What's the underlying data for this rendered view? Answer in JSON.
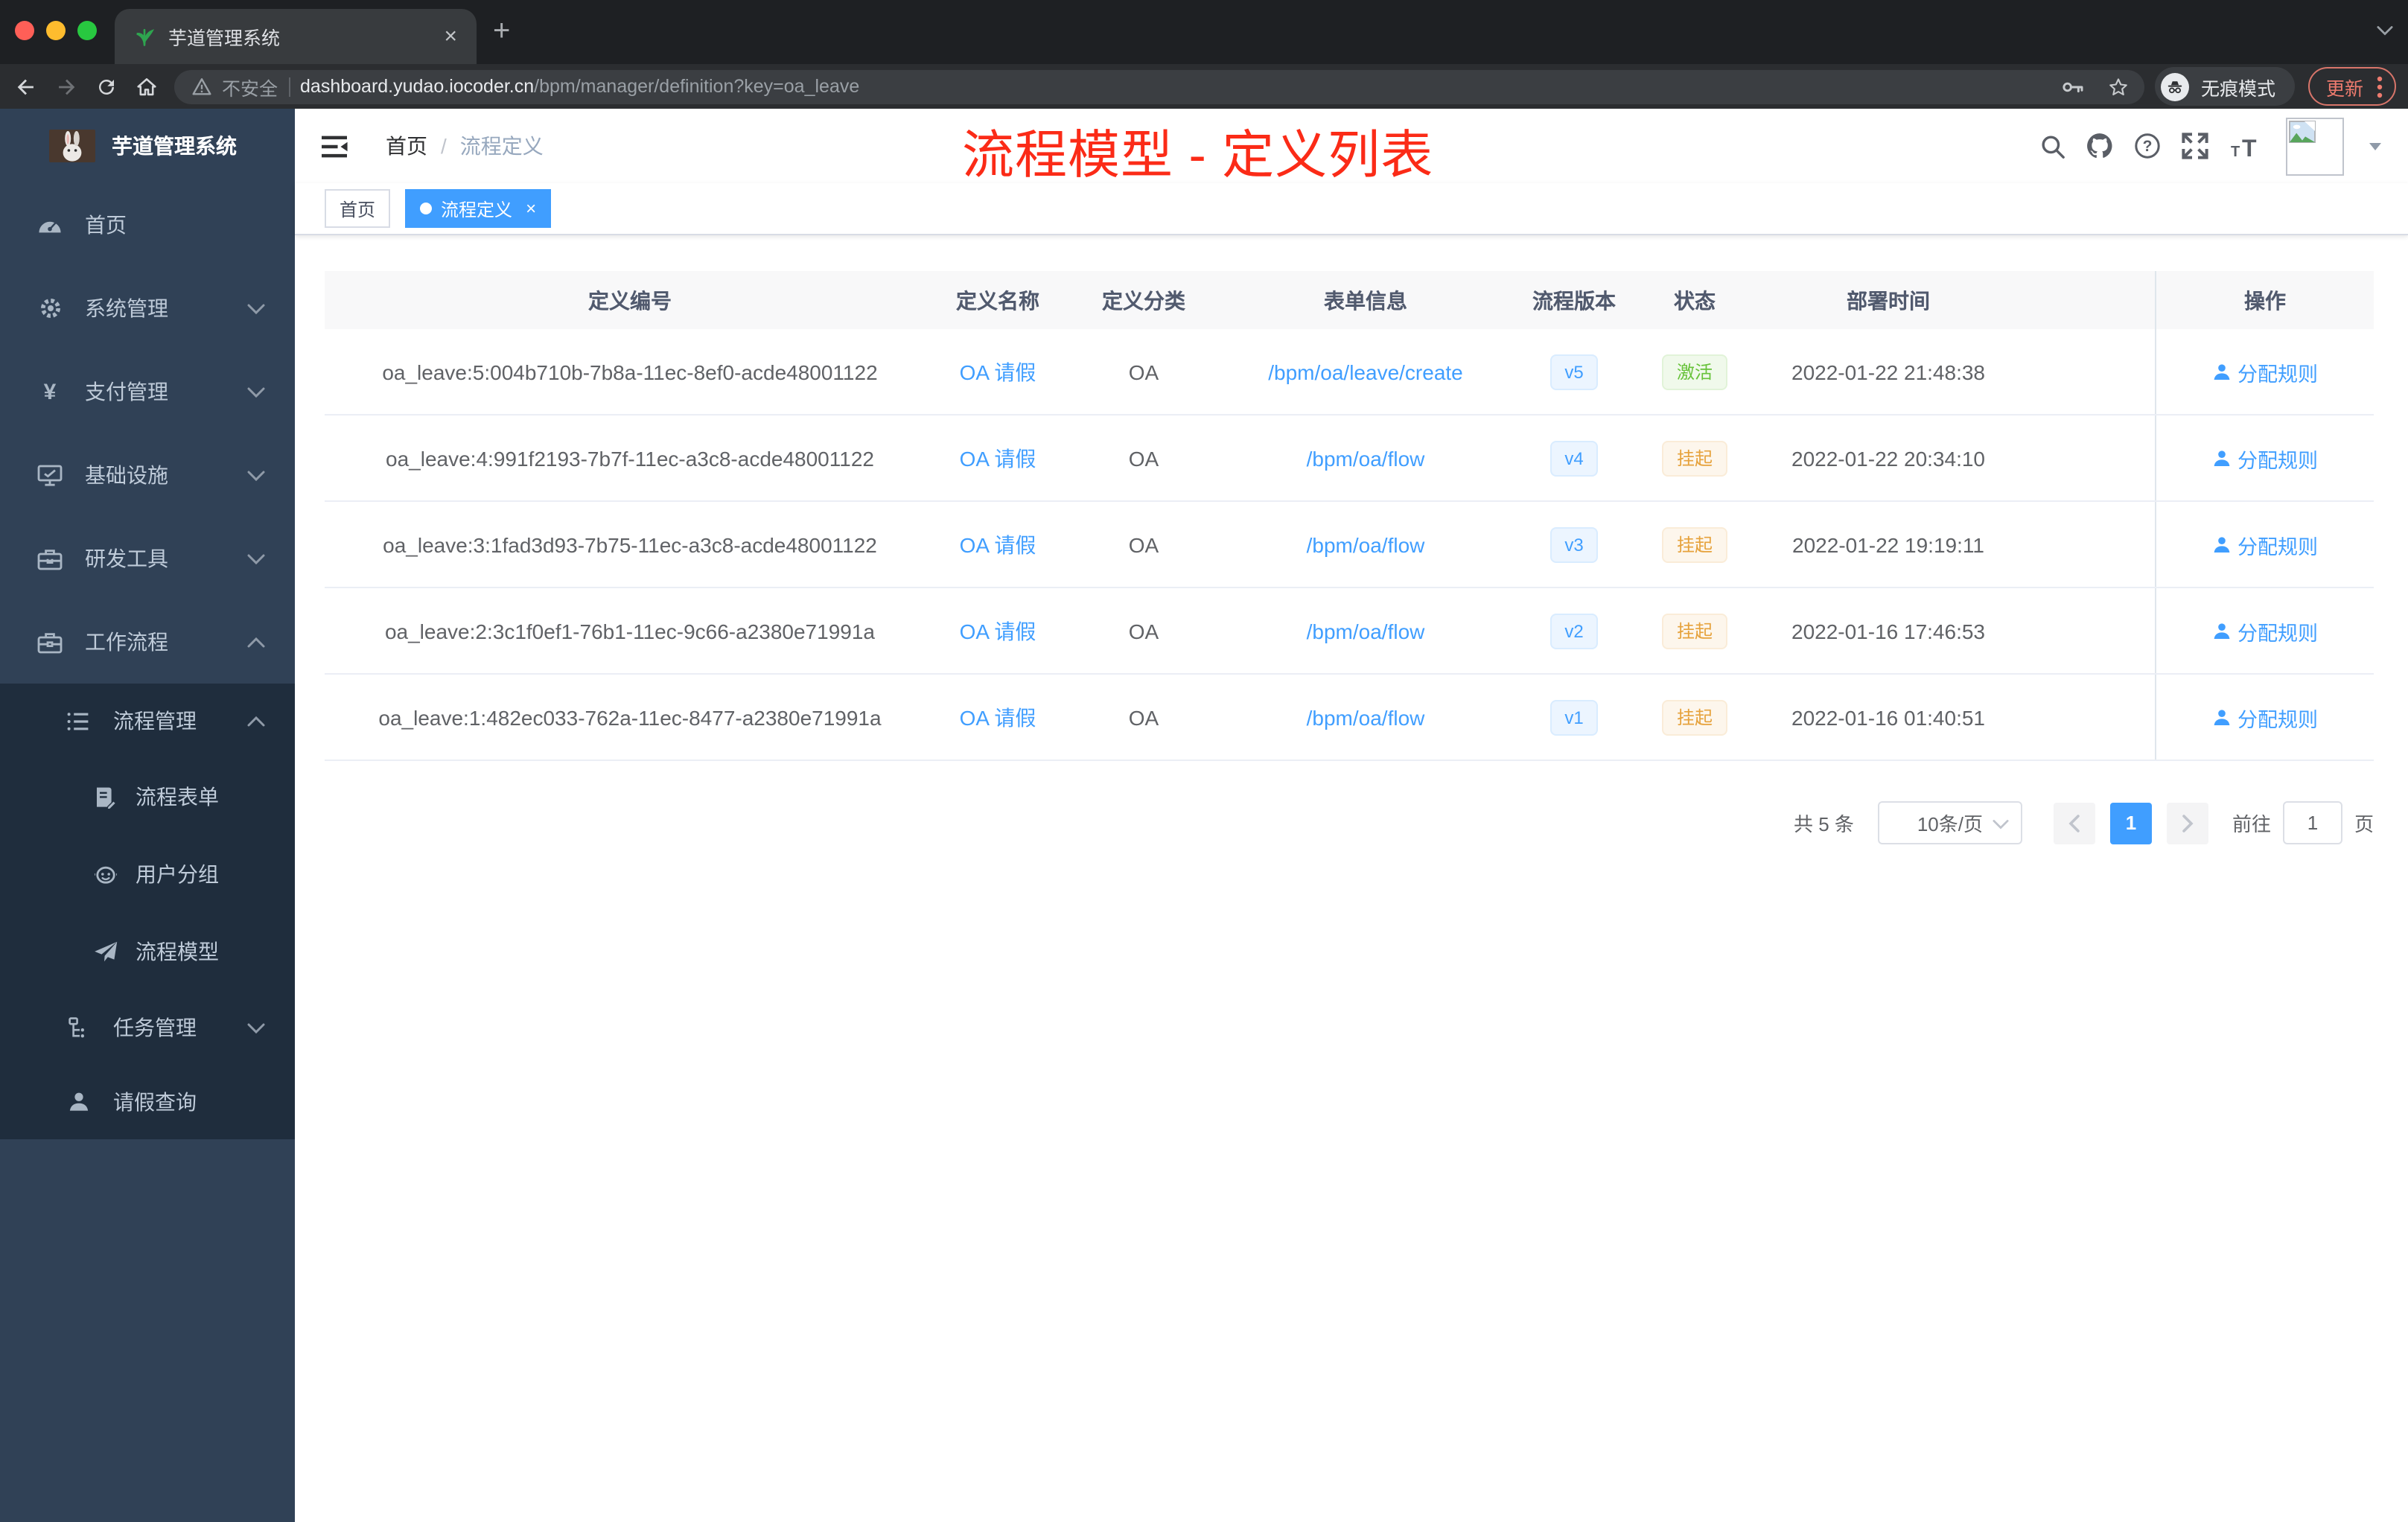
{
  "glyphs": {
    "close": "×",
    "plus": "+",
    "question_mark": "?",
    "yen": "¥",
    "font_small": "T",
    "font_large": "T",
    "slash": "/"
  },
  "browser": {
    "tab_title": "芋道管理系统",
    "insecure_label": "不安全",
    "url_host": "dashboard.yudao.iocoder.cn",
    "url_path": "/bpm/manager/definition?key=oa_leave",
    "incognito_label": "无痕模式",
    "update_label": "更新"
  },
  "sidebar": {
    "logo_title": "芋道管理系统",
    "items": [
      {
        "label": "首页",
        "icon": "dashboard-icon"
      },
      {
        "label": "系统管理",
        "icon": "gear-icon"
      },
      {
        "label": "支付管理",
        "icon": "yen-icon"
      },
      {
        "label": "基础设施",
        "icon": "monitor-icon"
      },
      {
        "label": "研发工具",
        "icon": "toolbox-icon"
      },
      {
        "label": "工作流程",
        "icon": "briefcase-icon"
      }
    ],
    "submenu": [
      {
        "label": "流程管理",
        "icon": "list-icon"
      },
      {
        "label": "流程表单",
        "icon": "form-icon"
      },
      {
        "label": "用户分组",
        "icon": "robot-icon"
      },
      {
        "label": "流程模型",
        "icon": "paper-plane-icon"
      },
      {
        "label": "任务管理",
        "icon": "tree-icon"
      },
      {
        "label": "请假查询",
        "icon": "user-icon"
      }
    ]
  },
  "header": {
    "breadcrumb_home": "首页",
    "breadcrumb_current": "流程定义",
    "annotation": "流程模型 - 定义列表"
  },
  "tags": {
    "home": "首页",
    "active": "流程定义"
  },
  "table": {
    "columns": [
      "定义编号",
      "定义名称",
      "定义分类",
      "表单信息",
      "流程版本",
      "状态",
      "部署时间",
      "操作"
    ],
    "rows": [
      {
        "id": "oa_leave:5:004b710b-7b8a-11ec-8ef0-acde48001122",
        "name": "OA 请假",
        "category": "OA",
        "form": "/bpm/oa/leave/create",
        "version": "v5",
        "status": "激活",
        "deploy_time": "2022-01-22 21:48:38",
        "action": "分配规则"
      },
      {
        "id": "oa_leave:4:991f2193-7b7f-11ec-a3c8-acde48001122",
        "name": "OA 请假",
        "category": "OA",
        "form": "/bpm/oa/flow",
        "version": "v4",
        "status": "挂起",
        "deploy_time": "2022-01-22 20:34:10",
        "action": "分配规则"
      },
      {
        "id": "oa_leave:3:1fad3d93-7b75-11ec-a3c8-acde48001122",
        "name": "OA 请假",
        "category": "OA",
        "form": "/bpm/oa/flow",
        "version": "v3",
        "status": "挂起",
        "deploy_time": "2022-01-22 19:19:11",
        "action": "分配规则"
      },
      {
        "id": "oa_leave:2:3c1f0ef1-76b1-11ec-9c66-a2380e71991a",
        "name": "OA 请假",
        "category": "OA",
        "form": "/bpm/oa/flow",
        "version": "v2",
        "status": "挂起",
        "deploy_time": "2022-01-16 17:46:53",
        "action": "分配规则"
      },
      {
        "id": "oa_leave:1:482ec033-762a-11ec-8477-a2380e71991a",
        "name": "OA 请假",
        "category": "OA",
        "form": "/bpm/oa/flow",
        "version": "v1",
        "status": "挂起",
        "deploy_time": "2022-01-16 01:40:51",
        "action": "分配规则"
      }
    ]
  },
  "pagination": {
    "total": "共 5 条",
    "page_size": "10条/页",
    "page": "1",
    "goto": "前往",
    "goto_value": "1",
    "unit": "页"
  },
  "colors": {
    "accent": "#409eff",
    "status_active": "#67c23a",
    "status_suspend": "#e6a23c",
    "annotation_red": "#fb2b17",
    "sidebar_bg": "#304156",
    "submenu_bg": "#1f2d3d"
  }
}
